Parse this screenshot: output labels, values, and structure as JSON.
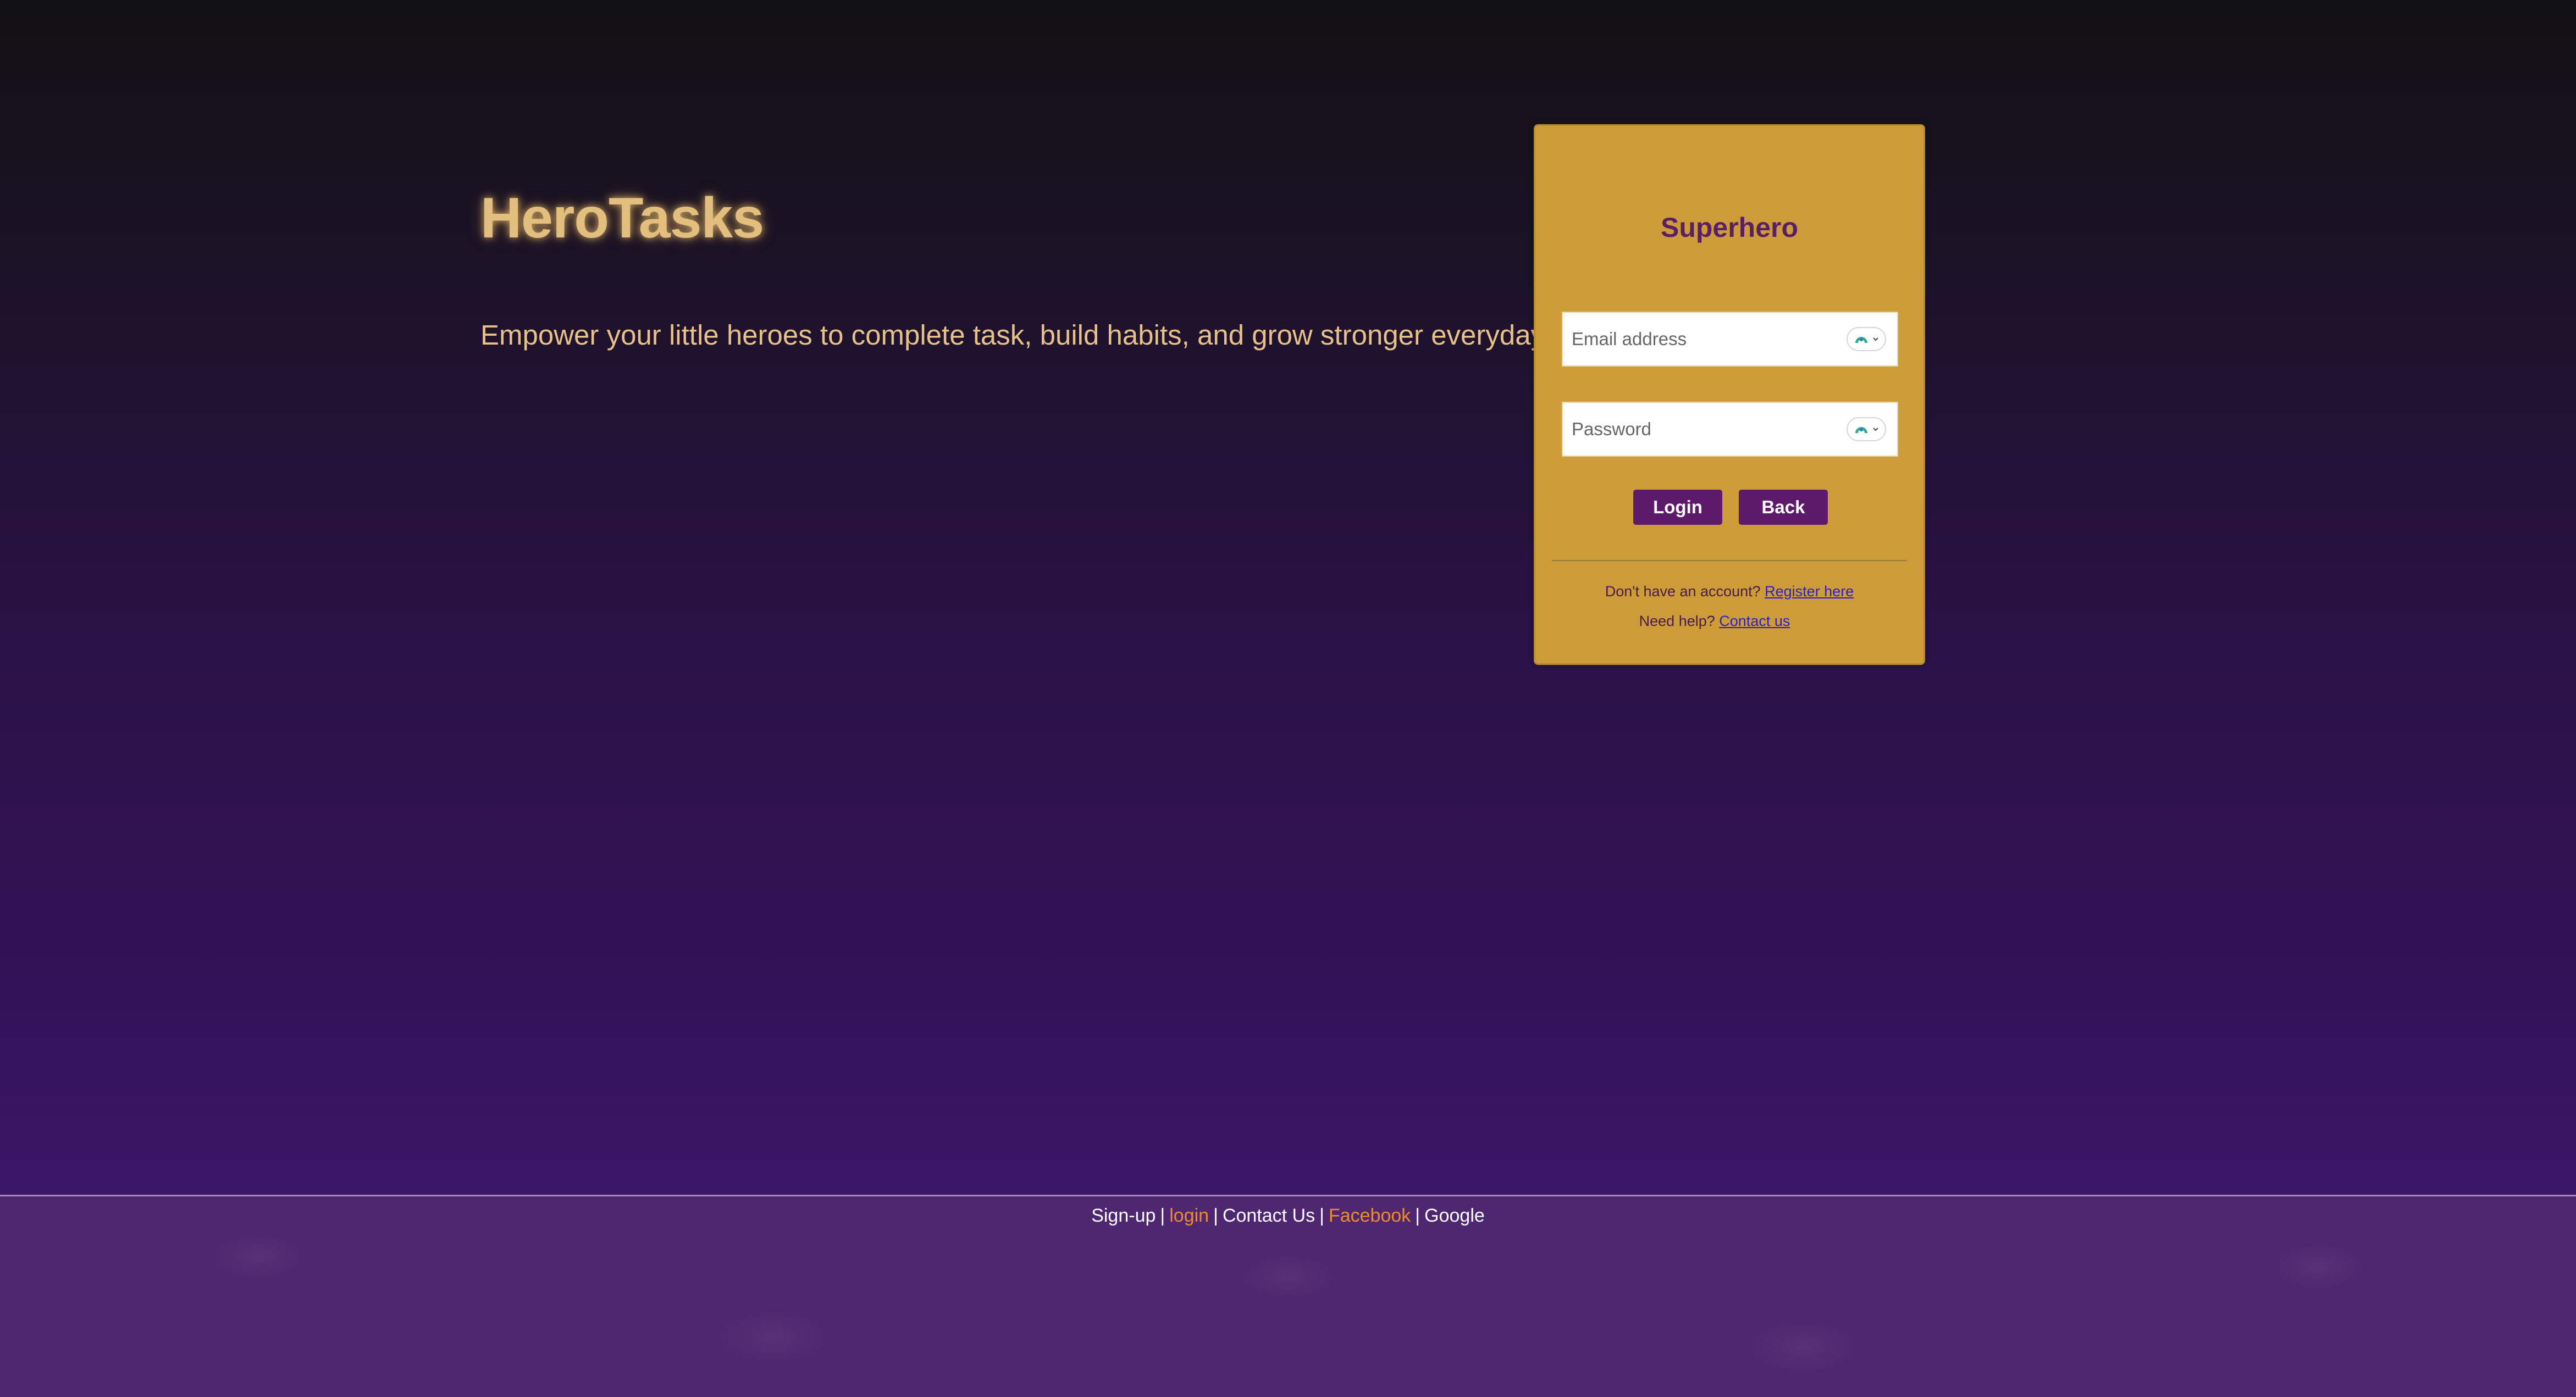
{
  "hero": {
    "title": "HeroTasks",
    "tagline": "Empower your little heroes to complete task, build habits, and grow stronger everyday"
  },
  "login_card": {
    "title": "Superhero",
    "email_placeholder": "Email address",
    "password_placeholder": "Password",
    "login_label": "Login",
    "back_label": "Back",
    "register_prompt": "Don't have an account?",
    "register_link": "Register here",
    "help_prompt": "Need help?",
    "contact_link": "Contact us"
  },
  "footer": {
    "links": [
      {
        "label": "Sign-up",
        "color": "#ffffff"
      },
      {
        "label": "login",
        "color": "#ee8a32"
      },
      {
        "label": "Contact Us",
        "color": "#ffffff"
      },
      {
        "label": "Facebook",
        "color": "#ee8a32"
      },
      {
        "label": "Google",
        "color": "#ffffff"
      }
    ],
    "separator": "|"
  },
  "icons": {
    "password_manager": "password-manager-icon"
  },
  "colors": {
    "card_background": "#cd9c38",
    "button_background": "#5e1a6a",
    "card_title": "#5b1f66",
    "hero_title": "#e2bf7e",
    "tagline": "#e8c08a",
    "footer_accent": "#ee8a32"
  }
}
